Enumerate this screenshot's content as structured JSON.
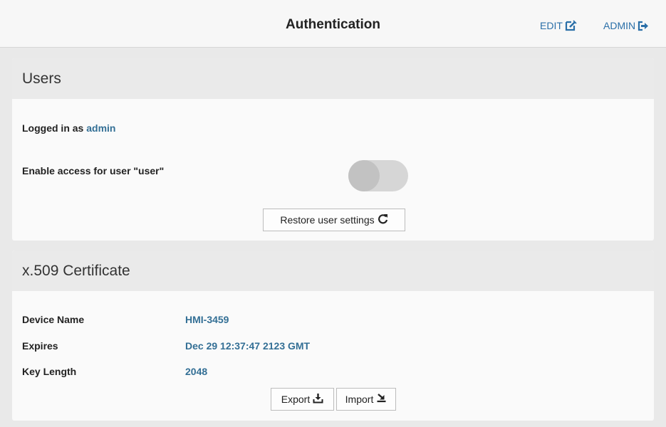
{
  "header": {
    "title": "Authentication",
    "edit_label": "EDIT",
    "admin_label": "ADMIN",
    "accent_color": "#2a6fa8"
  },
  "users": {
    "heading": "Users",
    "logged_in_prefix": "Logged in as",
    "logged_in_user": "admin",
    "enable_access_label": "Enable access for user \"user\"",
    "enable_access_on": false,
    "restore_label": "Restore user settings"
  },
  "certificate": {
    "heading": "x.509 Certificate",
    "fields": [
      {
        "label": "Device Name",
        "value": "HMI-3459"
      },
      {
        "label": "Expires",
        "value": "Dec 29 12:37:47 2123 GMT"
      },
      {
        "label": "Key Length",
        "value": "2048"
      }
    ],
    "export_label": "Export",
    "import_label": "Import"
  },
  "icons": {
    "edit": "edit-icon",
    "admin": "logout-icon",
    "restore": "refresh-icon",
    "export": "download-icon",
    "import": "import-icon"
  }
}
